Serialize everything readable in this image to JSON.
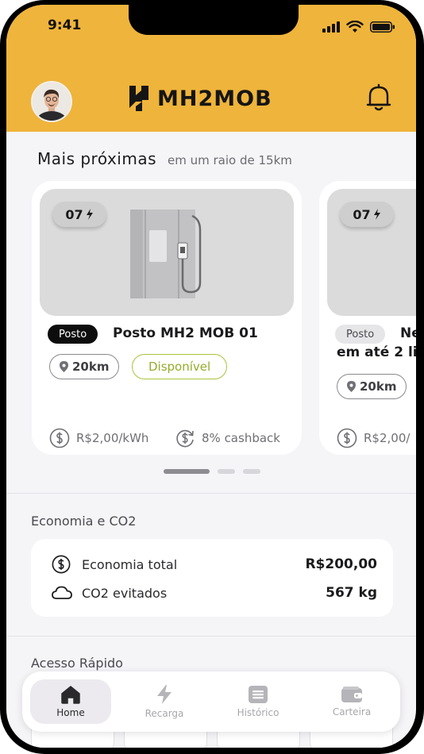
{
  "status_bar": {
    "time": "9:41"
  },
  "header": {
    "logo_text": "MH2MOB"
  },
  "nearby": {
    "title": "Mais próximas",
    "subtitle": "em um raio de 15km"
  },
  "cards": [
    {
      "count": "07",
      "tag": "Posto",
      "name": "Posto MH2 MOB 01",
      "distance": "20km",
      "status": "Disponível",
      "price": "R$2,00/kWh",
      "cashback": "8% cashback"
    },
    {
      "count": "07",
      "tag": "Posto",
      "name": "Ne",
      "name_line2": "em até 2 li",
      "distance": "20km",
      "price": "R$2,00/"
    }
  ],
  "carousel": {
    "pages": 3,
    "active": 0
  },
  "economy": {
    "title": "Economia e CO2",
    "rows": [
      {
        "label": "Economia total",
        "value": "R$200,00",
        "icon": "dollar-circle-icon"
      },
      {
        "label": "CO2 evitados",
        "value": "567 kg",
        "icon": "cloud-icon"
      }
    ]
  },
  "quick_access": {
    "title": "Acesso Rápido"
  },
  "nav": {
    "items": [
      {
        "label": "Home",
        "icon": "home-icon",
        "active": true
      },
      {
        "label": "Recarga",
        "icon": "bolt-icon",
        "active": false
      },
      {
        "label": "Histórico",
        "icon": "list-icon",
        "active": false
      },
      {
        "label": "Carteira",
        "icon": "wallet-icon",
        "active": false
      }
    ]
  },
  "colors": {
    "header": "#efb43b",
    "available": "#93ad2a",
    "background": "#f5f4f7"
  }
}
